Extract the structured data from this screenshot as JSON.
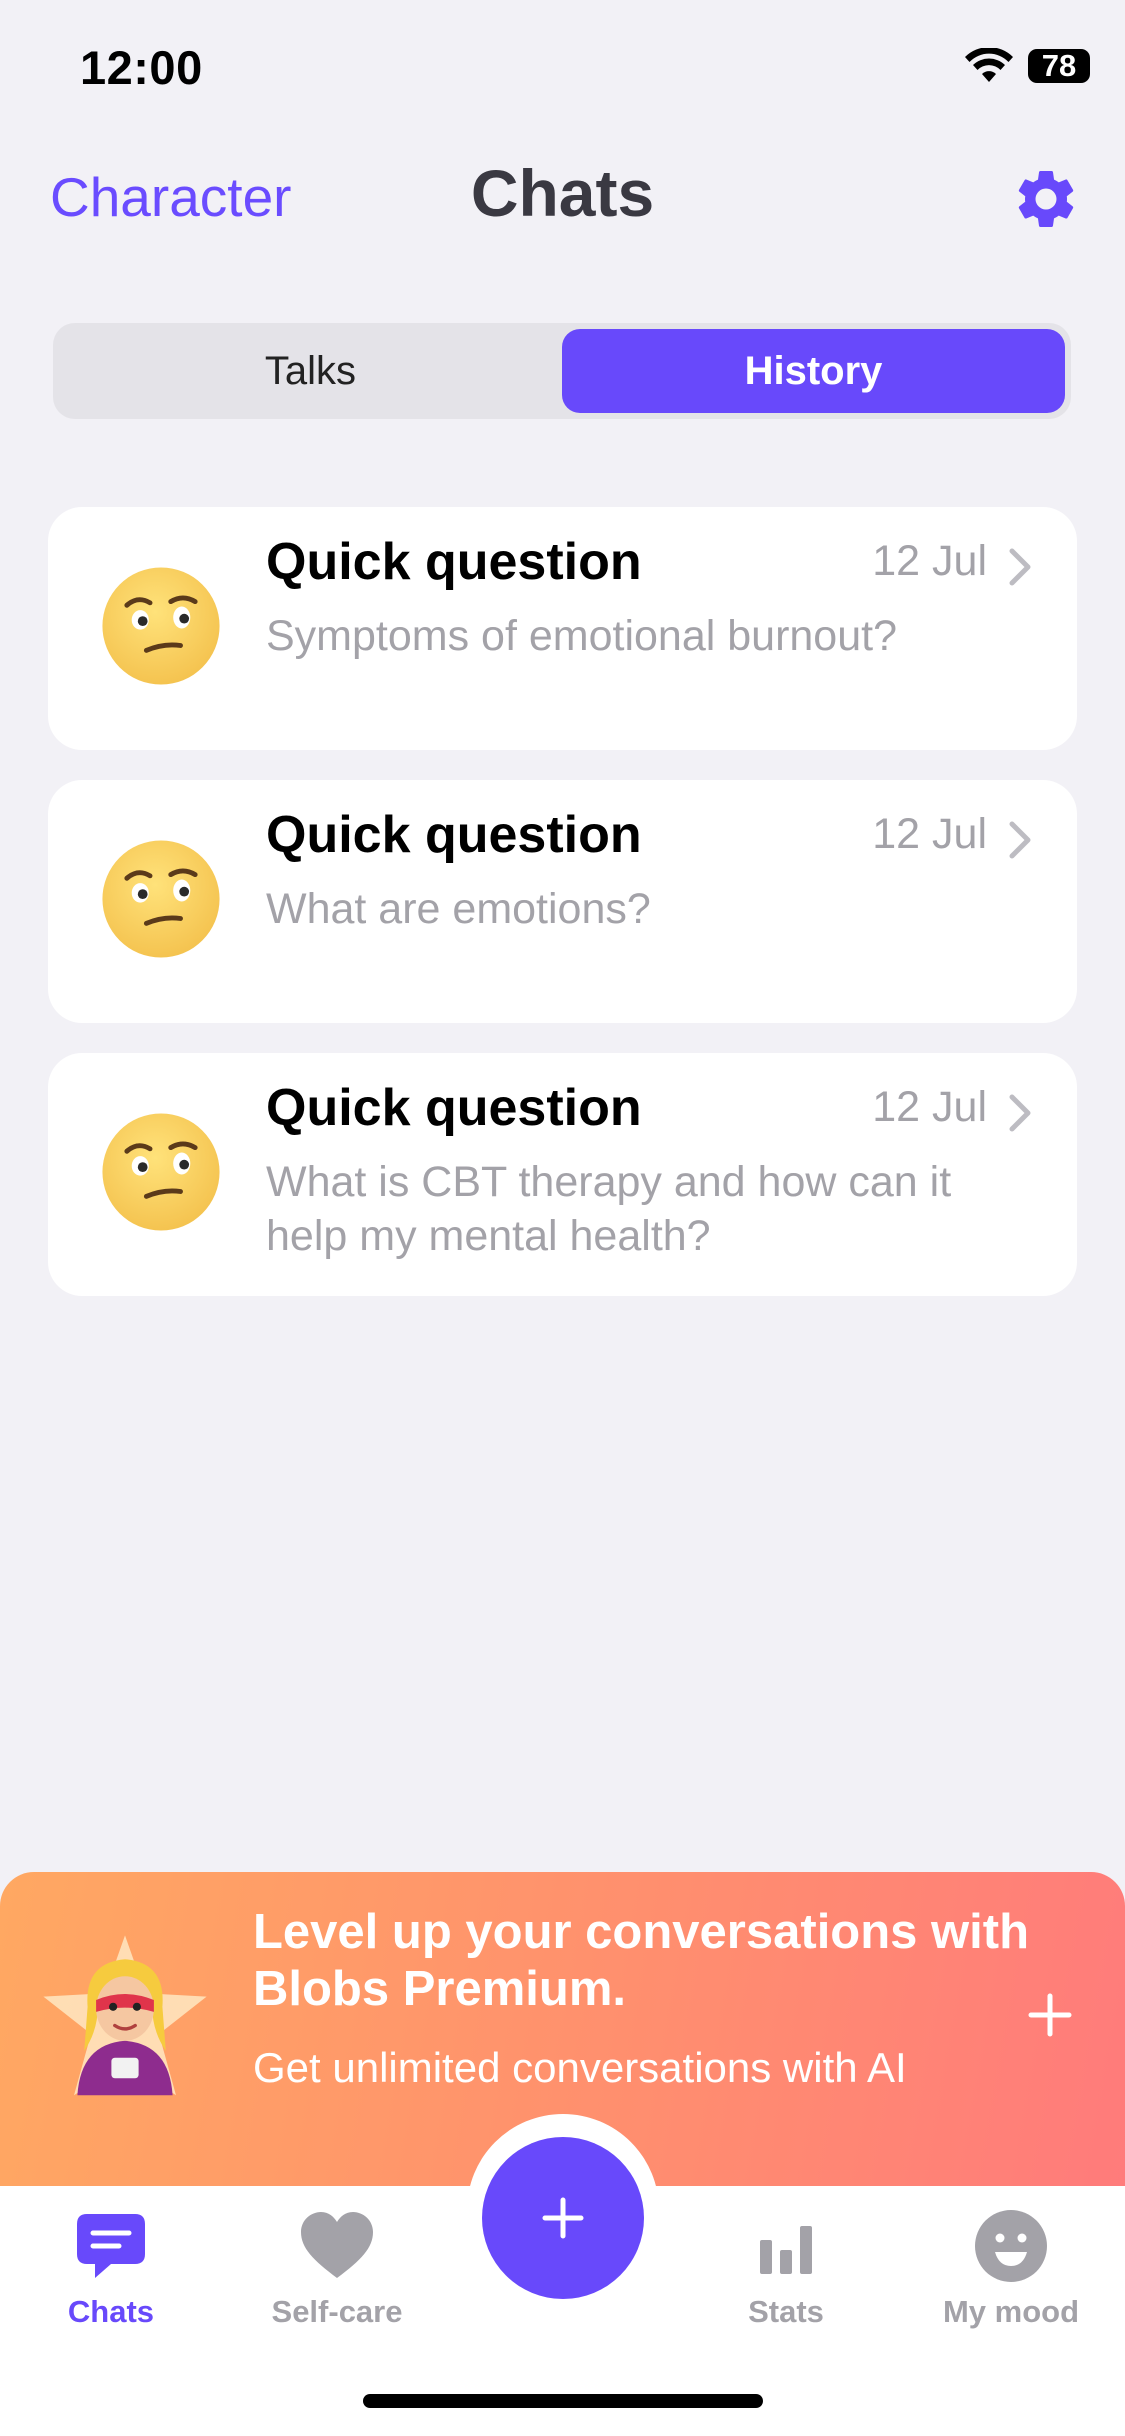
{
  "status_bar": {
    "time": "12:00",
    "battery": "78",
    "icons": [
      "wifi-icon",
      "battery-icon"
    ]
  },
  "header": {
    "left_link": "Character",
    "title": "Chats",
    "settings_icon": "gear-icon"
  },
  "segmented": {
    "tabs": [
      "Talks",
      "History"
    ],
    "selected": "History"
  },
  "chats": [
    {
      "title": "Quick question",
      "date": "12 Jul",
      "preview": "Symptoms of emotional burnout?",
      "icon": "raised-eyebrow-emoji"
    },
    {
      "title": "Quick question",
      "date": "12 Jul",
      "preview": "What are emotions?",
      "icon": "raised-eyebrow-emoji"
    },
    {
      "title": "Quick question",
      "date": "12 Jul",
      "preview": "What is CBT therapy and how can it help my mental health?",
      "icon": "raised-eyebrow-emoji"
    }
  ],
  "premium": {
    "headline": "Level up your conversations with Blobs Premium.",
    "subtext": "Get unlimited conversations with AI",
    "icon": "superhero-emoji"
  },
  "tabbar": {
    "items": [
      {
        "label": "Chats",
        "icon": "chat-bubble-icon",
        "active": true
      },
      {
        "label": "Self-care",
        "icon": "heart-icon",
        "active": false
      },
      {
        "label": "Stats",
        "icon": "bar-chart-icon",
        "active": false
      },
      {
        "label": "My mood",
        "icon": "smiley-icon",
        "active": false
      }
    ],
    "center_action_icon": "plus-icon"
  },
  "colors": {
    "accent": "#6849FB",
    "background": "#F2F1F6",
    "muted_text": "#A3A2A8",
    "banner_gradient_start": "#FFA862",
    "banner_gradient_end": "#FF7B7B"
  }
}
